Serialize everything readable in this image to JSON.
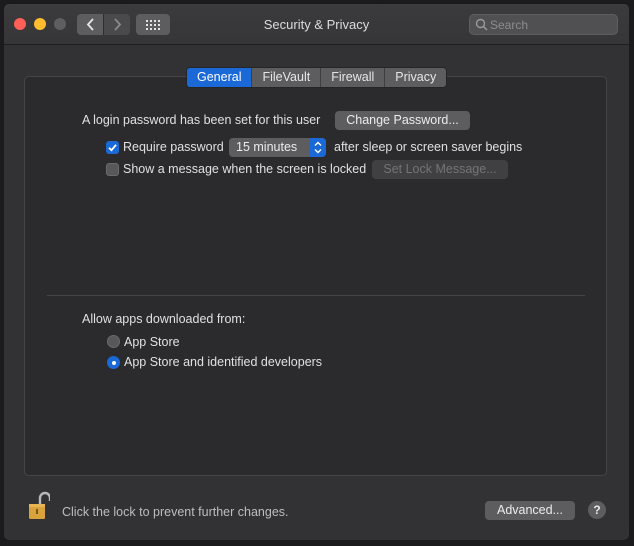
{
  "window": {
    "title": "Security & Privacy"
  },
  "search": {
    "placeholder": "Search",
    "value": ""
  },
  "tabs": [
    {
      "label": "General",
      "active": true
    },
    {
      "label": "FileVault",
      "active": false
    },
    {
      "label": "Firewall",
      "active": false
    },
    {
      "label": "Privacy",
      "active": false
    }
  ],
  "general": {
    "login_text": "A login password has been set for this user",
    "change_password_label": "Change Password...",
    "require_password": {
      "checked": true,
      "label": "Require password",
      "interval": "15 minutes",
      "suffix": "after sleep or screen saver begins"
    },
    "show_message": {
      "checked": false,
      "label": "Show a message when the screen is locked",
      "button_label": "Set Lock Message..."
    },
    "allow_apps": {
      "heading": "Allow apps downloaded from:",
      "options": [
        {
          "label": "App Store",
          "selected": false
        },
        {
          "label": "App Store and identified developers",
          "selected": true
        }
      ]
    }
  },
  "footer": {
    "lock_text": "Click the lock to prevent further changes.",
    "advanced_label": "Advanced...",
    "help_label": "?"
  },
  "colors": {
    "accent": "#1a69d7",
    "window_bg": "#323234",
    "panel_bg": "#2b2b2d",
    "lock_gold": "#d9a23b"
  },
  "icons": [
    "close-button",
    "minimize-button",
    "zoom-button",
    "chevron-left-icon",
    "chevron-right-icon",
    "grid-icon",
    "search-icon",
    "checkmark-icon",
    "stepper-arrows-icon",
    "lock-open-icon"
  ]
}
